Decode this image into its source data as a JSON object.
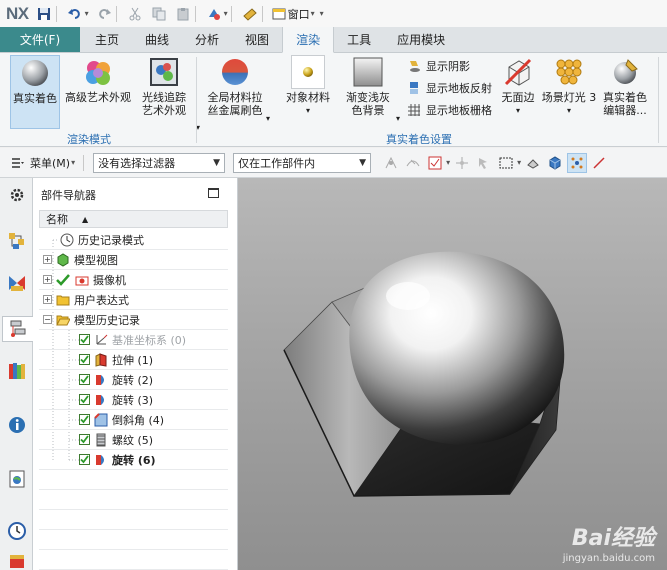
{
  "titlebar": {
    "logo": "NX",
    "window_menu": "窗口"
  },
  "tabs": {
    "file": "文件(F)",
    "items": [
      "主页",
      "曲线",
      "分析",
      "视图",
      "渲染",
      "工具",
      "应用模块"
    ],
    "active": "渲染"
  },
  "ribbon": {
    "buttons": {
      "true_shading": "真实着色",
      "advanced_art": "高级艺术外观",
      "ray_trace_1": "光线追踪",
      "ray_trace_2": "艺术外观",
      "global_material_1": "全局材料拉",
      "global_material_2": "丝金属刷色",
      "object_material": "对象材料",
      "gradient_bg_1": "渐变浅灰",
      "gradient_bg_2": "色背景",
      "show_shadow": "显示阴影",
      "show_floor_reflection": "显示地板反射",
      "show_floor_grid": "显示地板栅格",
      "no_face_edges": "无面边",
      "scene_lights": "场景灯光 3",
      "true_shading_editor_1": "真实着色",
      "true_shading_editor_2": "编辑器..."
    },
    "groups": {
      "render_mode": "渲染模式",
      "true_shading_settings": "真实着色设置"
    }
  },
  "cmdbar": {
    "menu": "菜单(M)",
    "filter": "没有选择过滤器",
    "scope": "仅在工作部件内"
  },
  "navigator": {
    "title": "部件导航器",
    "column_name": "名称",
    "rows": [
      {
        "label": "历史记录模式"
      },
      {
        "label": "模型视图"
      },
      {
        "label": "摄像机"
      },
      {
        "label": "用户表达式"
      },
      {
        "label": "模型历史记录"
      },
      {
        "label": "基准坐标系 (0)"
      },
      {
        "label": "拉伸 (1)"
      },
      {
        "label": "旋转 (2)"
      },
      {
        "label": "旋转 (3)"
      },
      {
        "label": "倒斜角 (4)"
      },
      {
        "label": "螺纹 (5)"
      },
      {
        "label": "旋转 (6)"
      }
    ]
  },
  "watermark": {
    "brand": "Bai经验",
    "url": "jingyan.baidu.com"
  }
}
